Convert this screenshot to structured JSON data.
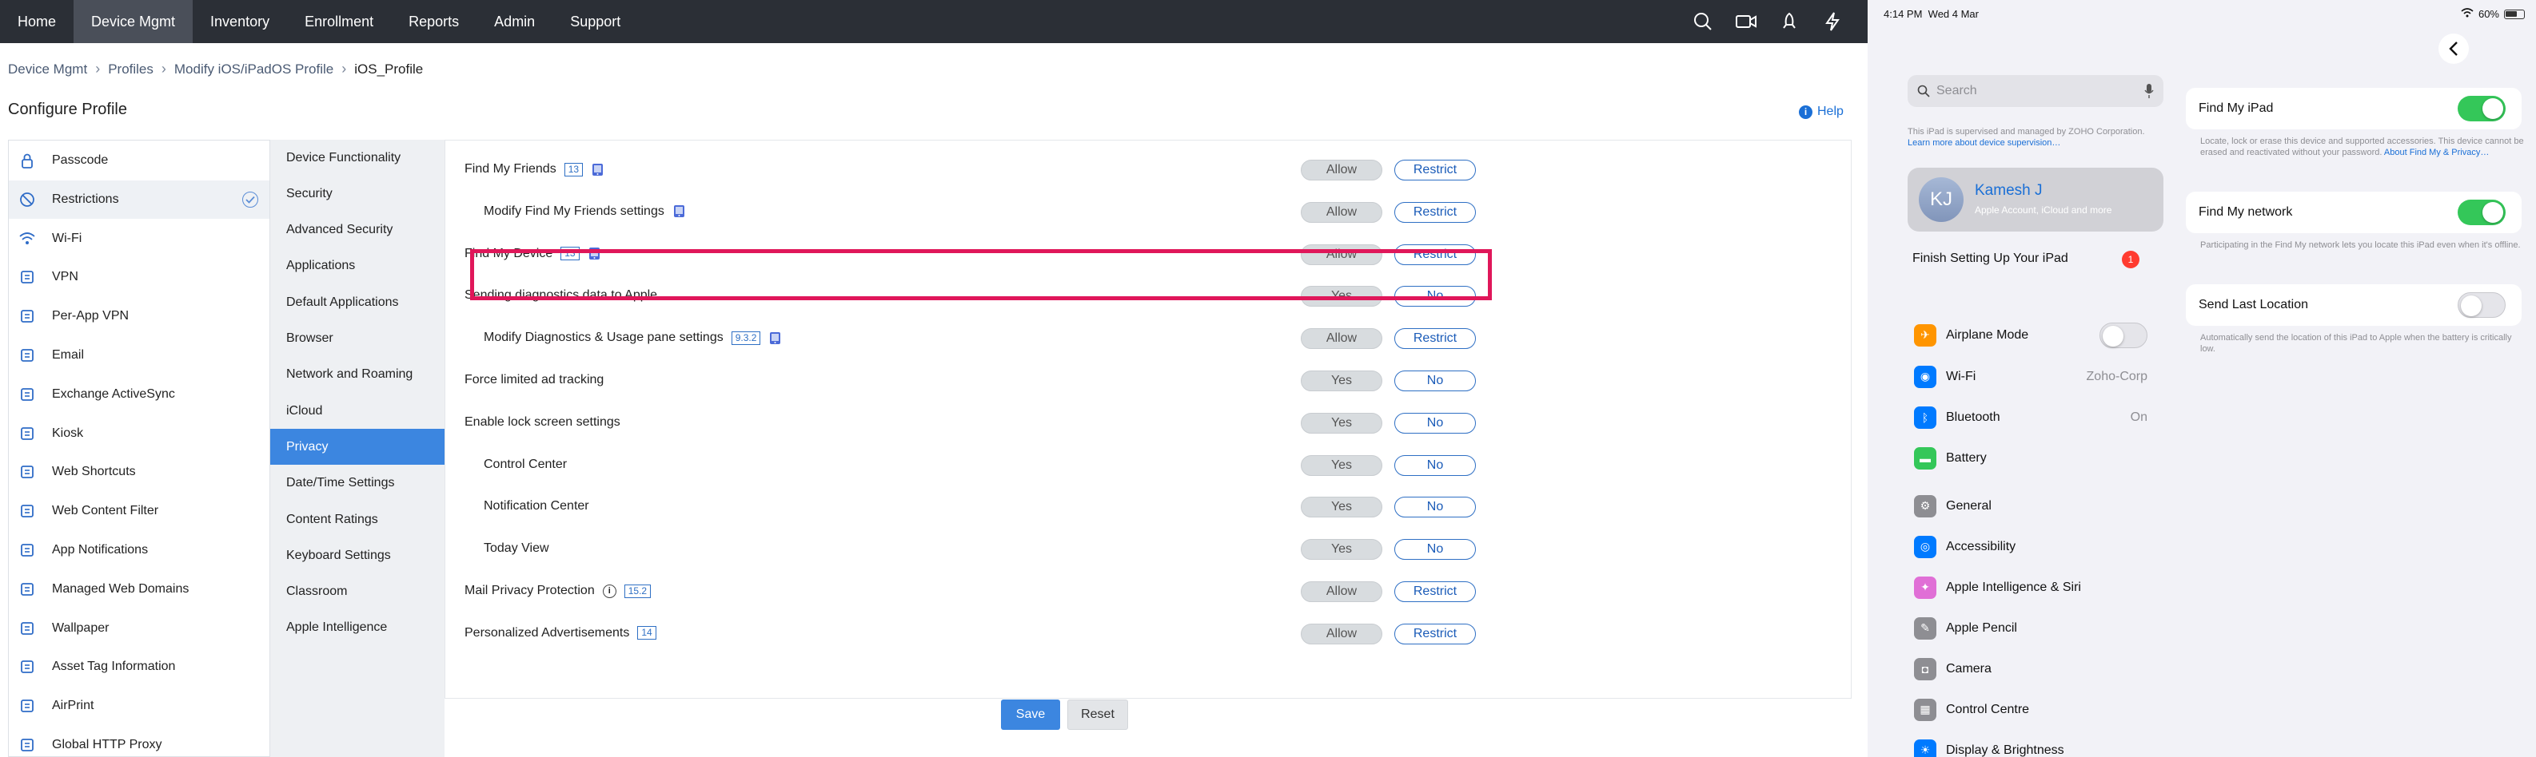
{
  "nav": {
    "tabs": [
      "Home",
      "Device Mgmt",
      "Inventory",
      "Enrollment",
      "Reports",
      "Admin",
      "Support"
    ],
    "active": 1
  },
  "breadcrumb": {
    "items": [
      "Device Mgmt",
      "Profiles",
      "Modify iOS/iPadOS Profile",
      "iOS_Profile"
    ]
  },
  "page": {
    "title": "Configure Profile",
    "help": "Help"
  },
  "payloads": {
    "items": [
      "Passcode",
      "Restrictions",
      "Wi-Fi",
      "VPN",
      "Per-App VPN",
      "Email",
      "Exchange ActiveSync",
      "Kiosk",
      "Web Shortcuts",
      "Web Content Filter",
      "App Notifications",
      "Managed Web Domains",
      "Wallpaper",
      "Asset Tag Information",
      "AirPrint",
      "Global HTTP Proxy"
    ],
    "icons": [
      "lock-icon",
      "no-entry-icon",
      "wifi-icon",
      "vpn-icon",
      "per-app-vpn-icon",
      "email-icon",
      "exchange-icon",
      "kiosk-icon",
      "web-shortcut-icon",
      "web-filter-icon",
      "app-notification-icon",
      "managed-domain-icon",
      "wallpaper-icon",
      "asset-tag-icon",
      "airprint-icon",
      "proxy-icon"
    ],
    "selected": 1
  },
  "categories": {
    "items": [
      "Device Functionality",
      "Security",
      "Advanced Security",
      "Applications",
      "Default Applications",
      "Browser",
      "Network and Roaming",
      "iCloud",
      "Privacy",
      "Date/Time Settings",
      "Content Ratings",
      "Keyboard Settings",
      "Classroom",
      "Apple Intelligence"
    ],
    "selected": 8
  },
  "restrictions": [
    {
      "label": "Find My Friends",
      "version": "13",
      "ipad": true,
      "info": false,
      "indent": false,
      "a": "Allow",
      "b": "Restrict"
    },
    {
      "label": "Modify Find My Friends settings",
      "version": "",
      "ipad": true,
      "info": false,
      "indent": true,
      "a": "Allow",
      "b": "Restrict"
    },
    {
      "label": "Find My Device",
      "version": "13",
      "ipad": true,
      "info": false,
      "indent": false,
      "a": "Allow",
      "b": "Restrict"
    },
    {
      "label": "Sending diagnostics data to Apple",
      "version": "",
      "ipad": false,
      "info": false,
      "indent": false,
      "a": "Yes",
      "b": "No"
    },
    {
      "label": "Modify Diagnostics & Usage pane settings",
      "version": "9.3.2",
      "ipad": true,
      "info": false,
      "indent": true,
      "a": "Allow",
      "b": "Restrict"
    },
    {
      "label": "Force limited ad tracking",
      "version": "",
      "ipad": false,
      "info": false,
      "indent": false,
      "a": "Yes",
      "b": "No"
    },
    {
      "label": "Enable lock screen settings",
      "version": "",
      "ipad": false,
      "info": false,
      "indent": false,
      "a": "Yes",
      "b": "No"
    },
    {
      "label": "Control Center",
      "version": "",
      "ipad": false,
      "info": false,
      "indent": true,
      "a": "Yes",
      "b": "No"
    },
    {
      "label": "Notification Center",
      "version": "",
      "ipad": false,
      "info": false,
      "indent": true,
      "a": "Yes",
      "b": "No"
    },
    {
      "label": "Today View",
      "version": "",
      "ipad": false,
      "info": false,
      "indent": true,
      "a": "Yes",
      "b": "No"
    },
    {
      "label": "Mail Privacy Protection",
      "version": "15.2",
      "ipad": false,
      "info": true,
      "indent": false,
      "a": "Allow",
      "b": "Restrict"
    },
    {
      "label": "Personalized Advertisements",
      "version": "14",
      "ipad": false,
      "info": false,
      "indent": false,
      "a": "Allow",
      "b": "Restrict"
    }
  ],
  "actions": {
    "save": "Save",
    "reset": "Reset"
  },
  "ipad": {
    "time": "4:14 PM",
    "date": "Wed 4 Mar",
    "battery": "60%",
    "search_placeholder": "Search",
    "supervision_note": "This iPad is supervised and managed by ZOHO Corporation. ",
    "supervision_link": "Learn more about device supervision…",
    "account": {
      "initials": "KJ",
      "name": "Kamesh J",
      "sub": "Apple Account, iCloud and more"
    },
    "finish": "Finish Setting Up Your iPad",
    "finish_badge": "1",
    "settings": [
      {
        "label": "Airplane Mode",
        "icon": "airplane-icon",
        "color": "#ff9500",
        "value": "",
        "toggle": "off"
      },
      {
        "label": "Wi-Fi",
        "icon": "wifi-icon",
        "color": "#007aff",
        "value": "Zoho-Corp",
        "toggle": ""
      },
      {
        "label": "Bluetooth",
        "icon": "bluetooth-icon",
        "color": "#007aff",
        "value": "On",
        "toggle": ""
      },
      {
        "label": "Battery",
        "icon": "battery-icon",
        "color": "#34c759",
        "value": "",
        "toggle": ""
      },
      {
        "label": "General",
        "icon": "gear-icon",
        "color": "#8e8e93",
        "value": "",
        "toggle": ""
      },
      {
        "label": "Accessibility",
        "icon": "accessibility-icon",
        "color": "#007aff",
        "value": "",
        "toggle": ""
      },
      {
        "label": "Apple Intelligence & Siri",
        "icon": "siri-icon",
        "color": "#e06fd6",
        "value": "",
        "toggle": ""
      },
      {
        "label": "Apple Pencil",
        "icon": "pencil-icon",
        "color": "#8e8e93",
        "value": "",
        "toggle": ""
      },
      {
        "label": "Camera",
        "icon": "camera-icon",
        "color": "#8e8e93",
        "value": "",
        "toggle": ""
      },
      {
        "label": "Control Centre",
        "icon": "control-centre-icon",
        "color": "#8e8e93",
        "value": "",
        "toggle": ""
      },
      {
        "label": "Display & Brightness",
        "icon": "brightness-icon",
        "color": "#007aff",
        "value": "",
        "toggle": ""
      }
    ],
    "findmy": {
      "ipad_label": "Find My iPad",
      "ipad_on": true,
      "ipad_note": "Locate, lock or erase this device and supported accessories. This device cannot be erased and reactivated without your password. ",
      "ipad_note_link": "About Find My & Privacy…",
      "network_label": "Find My network",
      "network_on": true,
      "network_note": "Participating in the Find My network lets you locate this iPad even when it's offline.",
      "last_label": "Send Last Location",
      "last_on": false,
      "last_note": "Automatically send the location of this iPad to Apple when the battery is critically low."
    }
  }
}
